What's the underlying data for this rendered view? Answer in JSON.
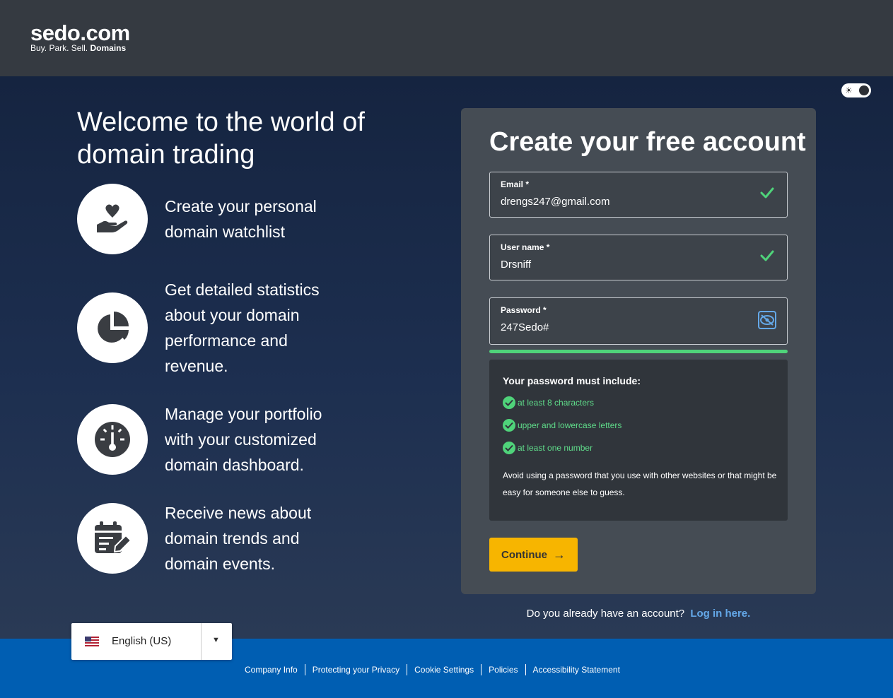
{
  "brand": {
    "name": "sedo.com",
    "tagline_a": "Buy.  Park.  Sell.",
    "tagline_b": "Domains"
  },
  "hero": {
    "headline": "Welcome to the world of domain trading",
    "features": [
      {
        "icon": "heart-hand-icon",
        "text": "Create your personal domain watchlist"
      },
      {
        "icon": "pie-chart-icon",
        "text": "Get detailed statistics about your domain performance and revenue."
      },
      {
        "icon": "dashboard-gauge-icon",
        "text": "Manage your portfolio with your customized domain dashboard."
      },
      {
        "icon": "calendar-edit-icon",
        "text": "Receive news about domain trends and domain events."
      }
    ]
  },
  "form": {
    "title": "Create your free account",
    "email": {
      "label": "Email *",
      "value": "drengs247@gmail.com"
    },
    "username": {
      "label": "User name *",
      "value": "Drsniff"
    },
    "password": {
      "label": "Password *",
      "value": "247Sedo#"
    },
    "rules": {
      "title": "Your password must include:",
      "items": [
        "at least 8 characters",
        "upper and lowercase letters",
        "at least one number"
      ],
      "note": "Avoid using a password that you use with other websites or that might be easy for someone else to guess."
    },
    "continue_label": "Continue",
    "login_prompt": "Do you already have an account?",
    "login_link": "Log in here."
  },
  "language": {
    "label": "English (US)"
  },
  "footer": {
    "links": [
      "Company Info",
      "Protecting your Privacy",
      "Cookie Settings",
      "Policies",
      "Accessibility Statement"
    ]
  },
  "colors": {
    "header_bg": "#353a41",
    "card_bg": "#454c54",
    "accent_yellow": "#f7b500",
    "success_green": "#4fd37a",
    "link_blue": "#64a8e8",
    "footer_blue": "#005eb2"
  }
}
